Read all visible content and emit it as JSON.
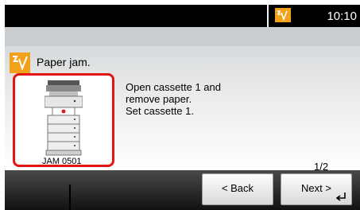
{
  "status_bar": {
    "time": "10:10",
    "alert_icon": "paper-jam-icon",
    "alert_color": "#f2a21a"
  },
  "message": {
    "icon": "paper-jam-icon",
    "title": "Paper jam.",
    "instructions": [
      "Open cassette 1 and",
      "remove paper.",
      "Set cassette 1."
    ],
    "illustration_code": "JAM 0501",
    "highlight_color": "#e21414"
  },
  "pager": {
    "text": "1/2"
  },
  "buttons": {
    "back_label": "< Back",
    "next_label": "Next >",
    "next_icon": "enter-icon"
  }
}
